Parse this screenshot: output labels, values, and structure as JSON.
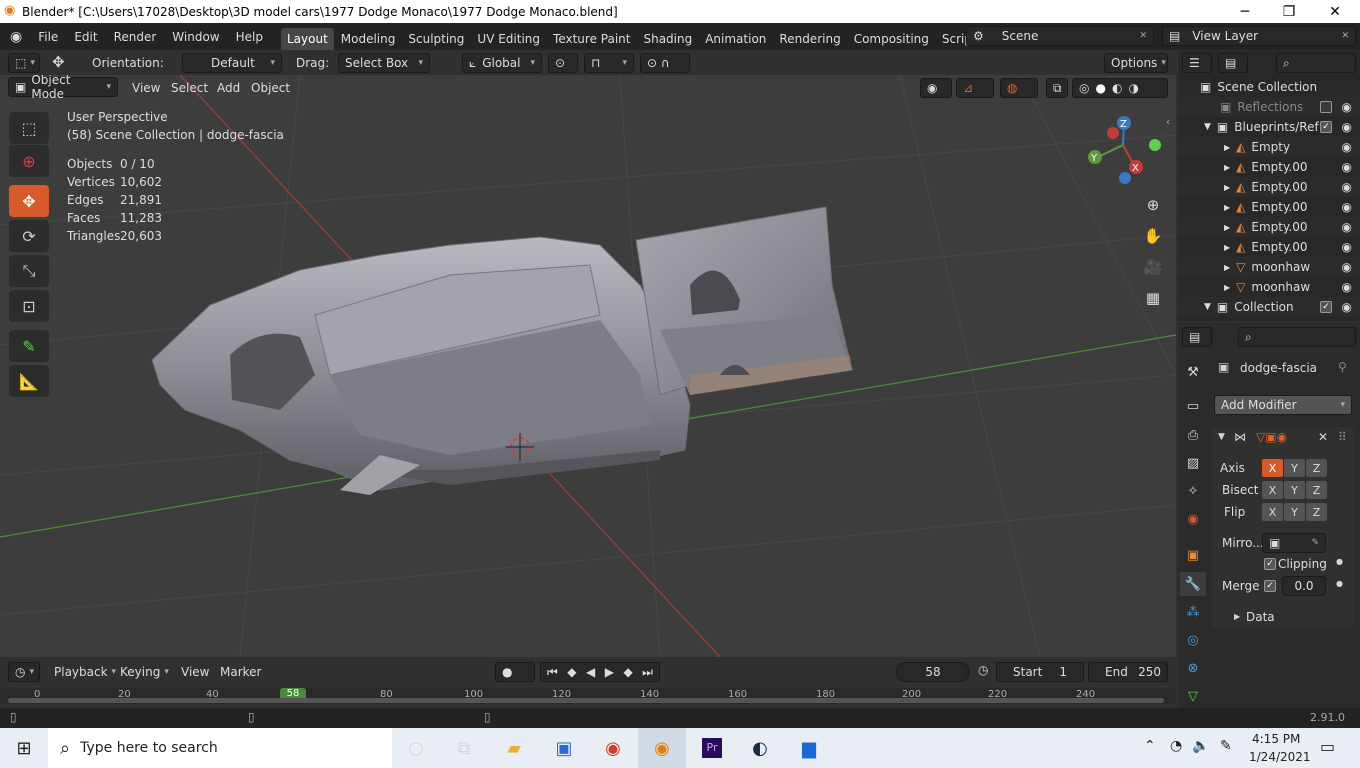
{
  "window": {
    "title": "Blender* [C:\\Users\\17028\\Desktop\\3D model cars\\1977 Dodge Monaco\\1977 Dodge Monaco.blend]",
    "minimize": "─",
    "maximize": "❐",
    "close": "✕"
  },
  "menubar": [
    "File",
    "Edit",
    "Render",
    "Window",
    "Help"
  ],
  "workspaces": [
    "Layout",
    "Modeling",
    "Sculpting",
    "UV Editing",
    "Texture Paint",
    "Shading",
    "Animation",
    "Rendering",
    "Compositing",
    "Scripting"
  ],
  "workspace_add": "+",
  "scene": {
    "label": "Scene",
    "view_layer": "View Layer"
  },
  "tool_header": {
    "orientation_label": "Orientation:",
    "orientation_value": "Default",
    "drag_label": "Drag:",
    "drag_value": "Select Box",
    "transform_orientation": "Global",
    "options": "Options"
  },
  "viewport_header": {
    "mode": "Object Mode",
    "menus": [
      "View",
      "Select",
      "Add",
      "Object"
    ]
  },
  "viewport_info": {
    "perspective": "User Perspective",
    "collection": "(58) Scene Collection | dodge-fascia"
  },
  "stats": [
    {
      "label": "Objects",
      "value": "0 / 10"
    },
    {
      "label": "Vertices",
      "value": "10,602"
    },
    {
      "label": "Edges",
      "value": "21,891"
    },
    {
      "label": "Faces",
      "value": "11,283"
    },
    {
      "label": "Triangles",
      "value": "20,603"
    }
  ],
  "gizmo": {
    "x": "X",
    "y": "Y",
    "z": "Z"
  },
  "outliner": {
    "items": [
      {
        "label": "Scene Collection",
        "indent": 0
      },
      {
        "label": "Reflections",
        "indent": 1,
        "dim": true
      },
      {
        "label": "Blueprints/Ref",
        "indent": 1
      },
      {
        "label": "Empty",
        "indent": 2
      },
      {
        "label": "Empty.00",
        "indent": 2
      },
      {
        "label": "Empty.00",
        "indent": 2
      },
      {
        "label": "Empty.00",
        "indent": 2
      },
      {
        "label": "Empty.00",
        "indent": 2
      },
      {
        "label": "Empty.00",
        "indent": 2
      },
      {
        "label": "moonhaw",
        "indent": 2
      },
      {
        "label": "moonhaw",
        "indent": 2
      },
      {
        "label": "Collection",
        "indent": 1
      }
    ]
  },
  "properties": {
    "object_name": "dodge-fascia",
    "add_modifier": "Add Modifier",
    "axis_label": "Axis",
    "bisect_label": "Bisect",
    "flip_label": "Flip",
    "mirror_label": "Mirro...",
    "clipping_label": "Clipping",
    "merge_label": "Merge",
    "merge_value": "0.0",
    "data_label": "Data",
    "axes": [
      "X",
      "Y",
      "Z"
    ]
  },
  "timeline": {
    "menus": [
      "Playback",
      "Keying",
      "View",
      "Marker"
    ],
    "current_frame": "58",
    "start_label": "Start",
    "start_value": "1",
    "end_label": "End",
    "end_value": "250",
    "ruler": [
      "0",
      "20",
      "40",
      "58",
      "80",
      "100",
      "120",
      "140",
      "160",
      "180",
      "200",
      "220",
      "240"
    ]
  },
  "status": {
    "version": "2.91.0"
  },
  "taskbar": {
    "search_placeholder": "Type here to search",
    "time": "4:15 PM",
    "date": "1/24/2021"
  },
  "colors": {
    "accent": "#d65a2a",
    "active_tab": "#474747",
    "viewport": "#3d3d3d"
  }
}
